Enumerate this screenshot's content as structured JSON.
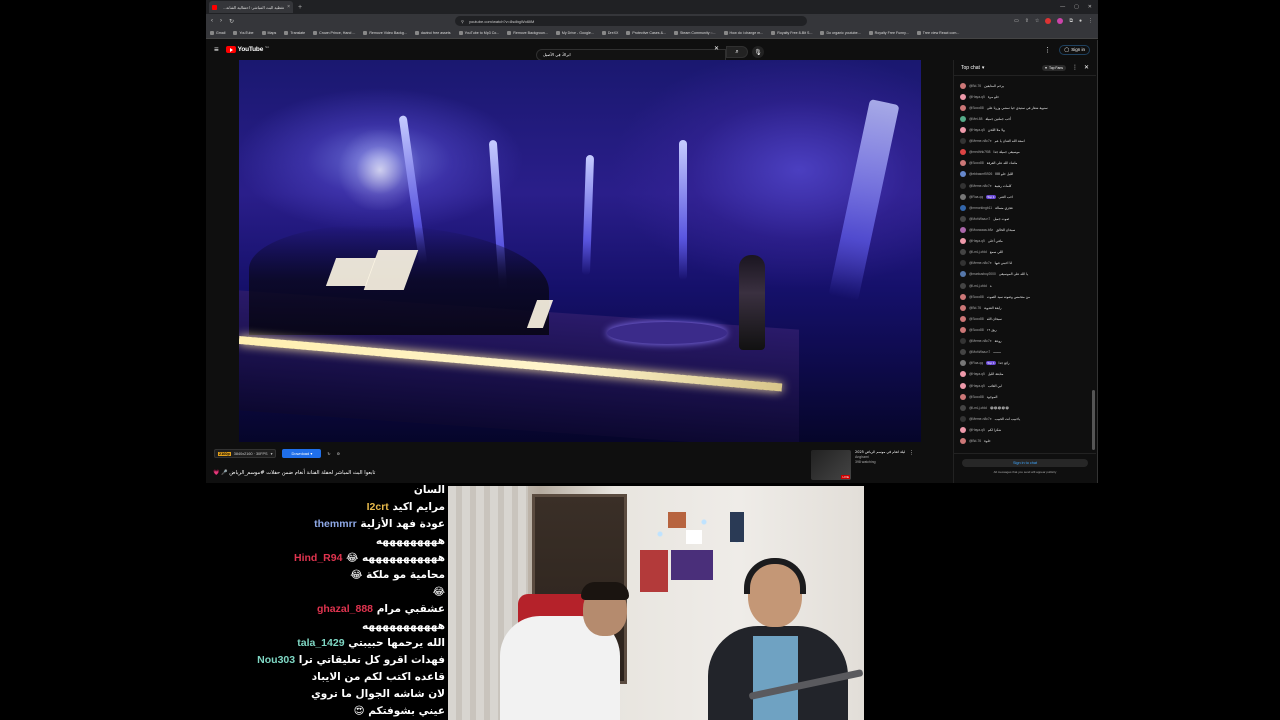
{
  "browser": {
    "tab_title": "تغطية البث المباشر: احتفالية الفنانة...",
    "url": "youtube.com/watch?v=8sdbgWo6IiM",
    "bookmarks": [
      "Gmail",
      "YouTube",
      "Maps",
      "Translate",
      "Crown Prince, Hand ...",
      "Remove Video Backg...",
      "davinci free assets",
      "YouTube to Mp3 Co...",
      "Remove Backgroun...",
      "My Drive - Google...",
      "DreXX",
      "Protective Cases &...",
      "Steam Community ::...",
      "How do i change m...",
      "Royalty Free 8-Bit S...",
      "Do organic youtube...",
      "Royalty Free Funny...",
      "Tree view React com..."
    ]
  },
  "youtube": {
    "logo_text": "YouTube",
    "logo_sup": "SA",
    "search_value": "ابراكَ فِي الأصيل",
    "signin_label": "Sign in"
  },
  "download_bar": {
    "quality_badge": "2160p",
    "quality_text": "3840x2160 · 30FPS",
    "download_label": "Download"
  },
  "video": {
    "title": "تابعوا البث المباشر لحفلة الفنانة أنغام ضمن حفلات #موسم_الرياض 🎤 💗"
  },
  "recommended": {
    "title": "ليلة انغام في موسم الرياض 2025",
    "channel": "Anghami",
    "watching": "398 watching",
    "live": "LIVE"
  },
  "live_chat": {
    "header": "Top chat",
    "fans_badge": "Top Fans",
    "messages": [
      {
        "user": "@Bd-76",
        "text": "يرحم المتابعين",
        "color": "#c77"
      },
      {
        "user": "@Haya-q5",
        "text": "حلو مرة",
        "color": "#e9a"
      },
      {
        "user": "@Sooo88",
        "text": "سنوية شعار في ستيدي حيا تمشي وزرنا على",
        "color": "#c77"
      },
      {
        "user": "@Mei-88",
        "text": "أحب جملتين جميلة",
        "color": "#5a8"
      },
      {
        "user": "@Haya-q5",
        "text": "ولا ملا اللحن",
        "color": "#e9a"
      },
      {
        "user": "@Meme-n8c7e",
        "text": "اسعد الله الفنان يا عم",
        "color": "#333"
      },
      {
        "user": "@medhhk7f08",
        "text": "موسيقى جميلة جدا",
        "color": "#d44"
      },
      {
        "user": "@Sooo88",
        "text": "ماشاء الله على الفرقة",
        "color": "#c77"
      },
      {
        "user": "@ebbasmf5926",
        "text": "الليل حلو ااااا",
        "color": "#68c"
      },
      {
        "user": "@Meme-n8c7e",
        "text": "كلمات رهيبة",
        "color": "#333"
      },
      {
        "user": "@Roa-qq",
        "text": "احب الغنى",
        "color": "#777",
        "badge": "Top 1"
      },
      {
        "user": "@mmorkingb11",
        "text": "عجزي مسالة",
        "color": "#36a"
      },
      {
        "user": "@MohWaa-n7",
        "text": "صوت جميل",
        "color": "#444"
      },
      {
        "user": "@Moowaaa-b8z",
        "text": "سبحان الخالق",
        "color": "#a6a"
      },
      {
        "user": "@Haya-q5",
        "text": "مافي أحلى",
        "color": "#e9a"
      },
      {
        "user": "@LmLj-cfdd",
        "text": "اللي سمع",
        "color": "#444"
      },
      {
        "user": "@Meme-n8c7e",
        "text": "انا احبني فيها",
        "color": "#333"
      },
      {
        "user": "@markusboy2000",
        "text": "يا الله على الموسيقى",
        "color": "#57a"
      },
      {
        "user": "@LmLj-cfdd",
        "text": "ه",
        "color": "#444"
      },
      {
        "user": "@Sooo88",
        "text": "من متحمس وصوته سيد الصوت",
        "color": "#c77"
      },
      {
        "user": "@Bd-76",
        "text": "رابعة العدوية",
        "color": "#c77"
      },
      {
        "user": "@Sooo88",
        "text": "سبحان الله",
        "color": "#c77"
      },
      {
        "user": "@Sooo88",
        "text": "ريق ١٩",
        "color": "#c77"
      },
      {
        "user": "@Meme-n8c7e",
        "text": "روعة",
        "color": "#333"
      },
      {
        "user": "@MohWaa-n7",
        "text": "ــــــــ",
        "color": "#444"
      },
      {
        "user": "@Roa-qq",
        "text": "رائع جدا",
        "color": "#777",
        "badge": "Top 1"
      },
      {
        "user": "@Haya-q5",
        "text": "متابعة الليل",
        "color": "#e9a"
      },
      {
        "user": "@Haya-q5",
        "text": "ابي الغائب",
        "color": "#e9a"
      },
      {
        "user": "@Sooo88",
        "text": "الموجود",
        "color": "#c77"
      },
      {
        "user": "@LmLj-cfdd",
        "text": "😂😂😂😂😂",
        "color": "#444"
      },
      {
        "user": "@Meme-n8c7e",
        "text": "ياحبيب انت الحبيب",
        "color": "#333"
      },
      {
        "user": "@Haya-q5",
        "text": "شكرا لكم",
        "color": "#e9a"
      },
      {
        "user": "@Bd-76",
        "text": "حلوة",
        "color": "#c77"
      }
    ],
    "signin_button": "Sign in to chat",
    "footer_note": "All messages that you send will appear publicly"
  },
  "stream_chat": {
    "lines": [
      {
        "user": "",
        "text": "السان"
      },
      {
        "user": "I2crt",
        "text": "مرايم اكيد",
        "color": "#e6b94b"
      },
      {
        "user": "themmrr",
        "text": "عودة فهد الأزلية",
        "color": "#8ea8e6"
      },
      {
        "user": "",
        "text": "هههههههههه"
      },
      {
        "user": "Hind_R94",
        "text": "هههههههههههه 😂",
        "color": "#e0344f"
      },
      {
        "user": "",
        "text": "محامية مو ملكة 😂"
      },
      {
        "user": "",
        "text": "😂"
      },
      {
        "user": "ghazal_888",
        "text": "عشقبي مرام",
        "color": "#e0344f"
      },
      {
        "user": "",
        "text": "هههههههههههه"
      },
      {
        "user": "tala_1429",
        "text": "الله يرحمها حبيبتي",
        "color": "#7fd7c4"
      },
      {
        "user": "Nou303",
        "text": "فهدات اقرو كل تعليقاتي ترا",
        "color": "#7fd7c4"
      },
      {
        "user": "",
        "text": "قاعده اكتب لكم من الايباد"
      },
      {
        "user": "",
        "text": "لان شاشه الجوال ما تروي"
      },
      {
        "user": "",
        "text": "عيني بشوفتكم 😍"
      }
    ]
  }
}
